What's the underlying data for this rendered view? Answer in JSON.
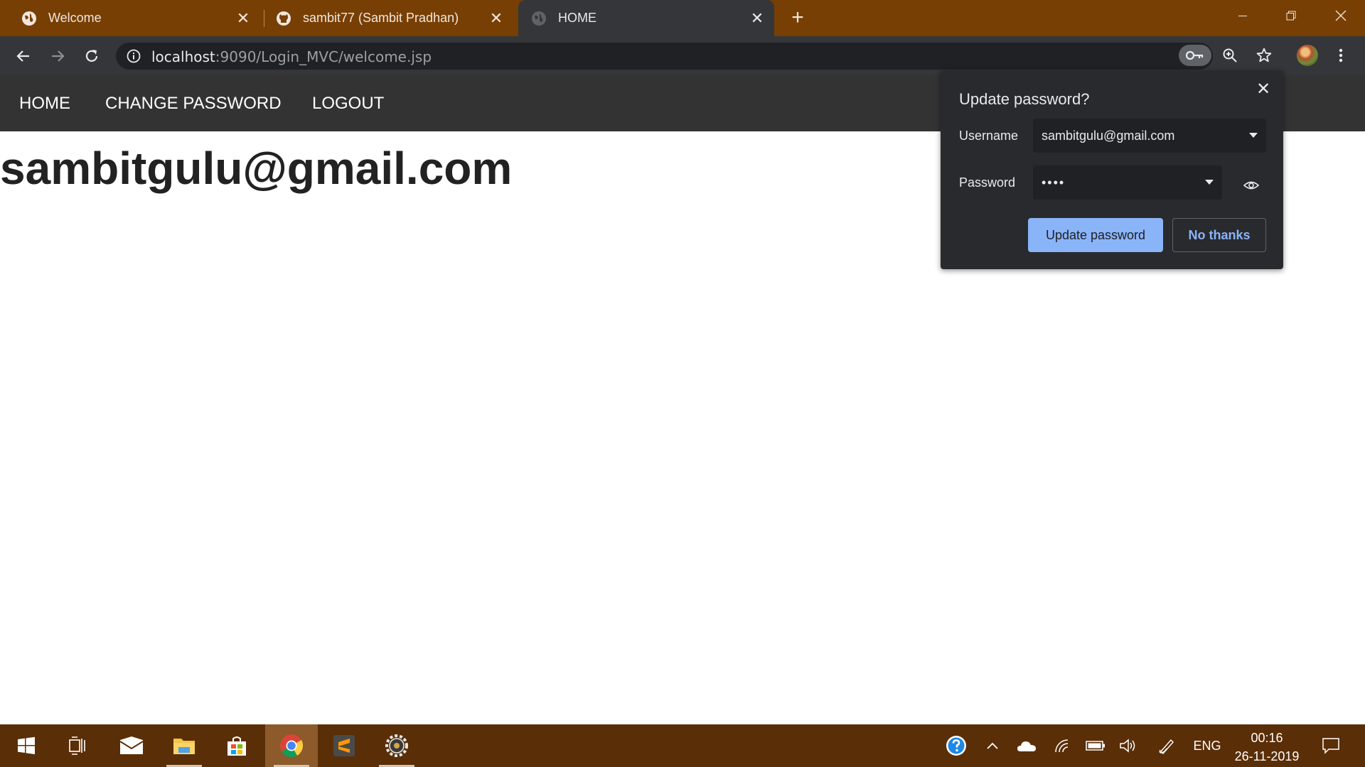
{
  "browser": {
    "tabs": [
      {
        "title": "Welcome",
        "favicon": "globe-icon"
      },
      {
        "title": "sambit77 (Sambit Pradhan)",
        "favicon": "github-icon"
      },
      {
        "title": "HOME",
        "favicon": "globe-icon"
      }
    ],
    "active_tab": 2,
    "url_host": "localhost",
    "url_rest": ":9090/Login_MVC/welcome.jsp"
  },
  "site": {
    "nav": [
      "HOME",
      "CHANGE PASSWORD",
      "LOGOUT"
    ],
    "email_heading": "sambitgulu@gmail.com"
  },
  "password_prompt": {
    "title": "Update password?",
    "username_label": "Username",
    "username_value": "sambitgulu@gmail.com",
    "password_label": "Password",
    "password_value": "••••",
    "update_label": "Update password",
    "decline_label": "No thanks"
  },
  "taskbar": {
    "apps": [
      "start",
      "task-view",
      "mail",
      "file-explorer",
      "store",
      "chrome",
      "sublime-text",
      "settings"
    ],
    "tray_language": "ENG",
    "time": "00:16",
    "date": "26-11-2019"
  },
  "colors": {
    "title_bar": "#783f04",
    "taskbar": "#5a2e07",
    "toolbar": "#35363a",
    "site_nav": "#333333",
    "popup_bg": "#292a2d",
    "accent": "#8ab4f8"
  }
}
